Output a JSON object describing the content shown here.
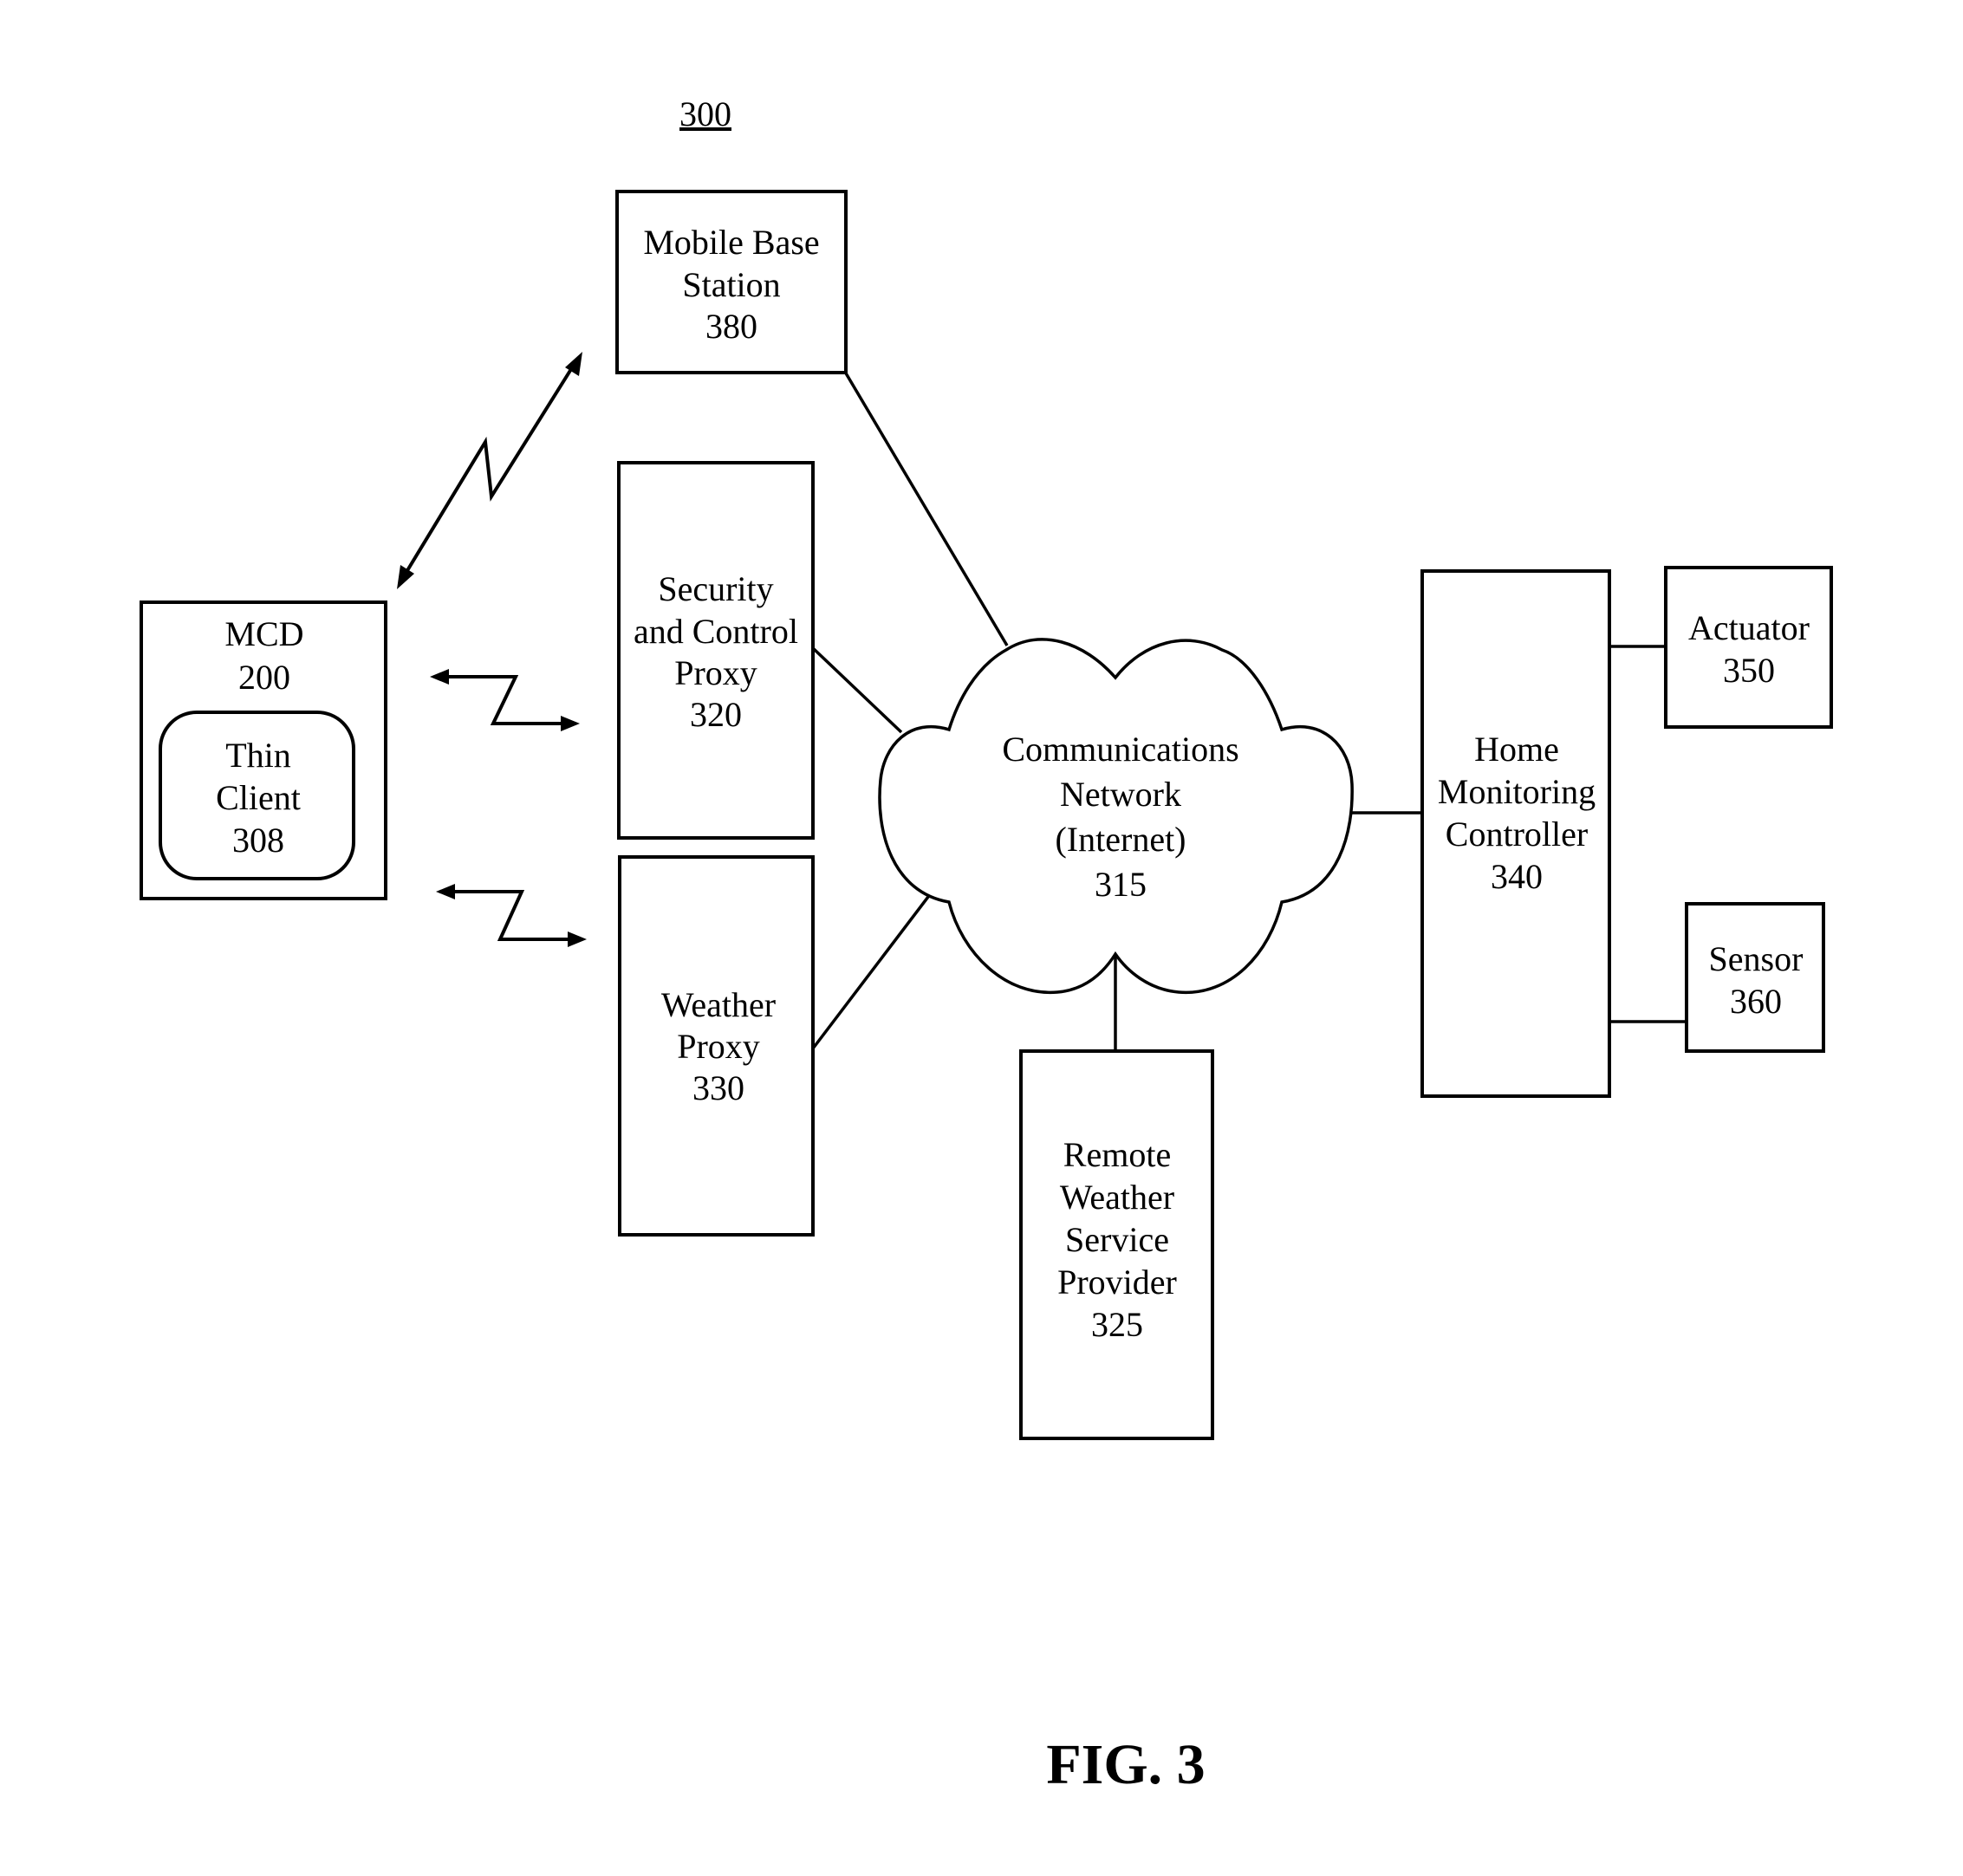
{
  "figure": {
    "reference_number": "300",
    "caption": "FIG. 3"
  },
  "nodes": {
    "mobile_base_station": {
      "lines": [
        "Mobile Base",
        "Station",
        "380"
      ]
    },
    "mcd": {
      "lines": [
        "MCD",
        "200"
      ]
    },
    "thin_client": {
      "lines": [
        "Thin",
        "Client",
        "308"
      ]
    },
    "security_proxy": {
      "lines": [
        "Security",
        "and Control",
        "Proxy",
        "320"
      ]
    },
    "weather_proxy": {
      "lines": [
        "Weather",
        "Proxy",
        "330"
      ]
    },
    "network": {
      "lines": [
        "Communications",
        "Network",
        "(Internet)",
        "315"
      ]
    },
    "remote_weather": {
      "lines": [
        "Remote",
        "Weather",
        "Service",
        "Provider",
        "325"
      ]
    },
    "home_controller": {
      "lines": [
        "Home",
        "Monitoring",
        "Controller",
        "340"
      ]
    },
    "actuator": {
      "lines": [
        "Actuator",
        "350"
      ]
    },
    "sensor": {
      "lines": [
        "Sensor",
        "360"
      ]
    }
  },
  "connections": [
    {
      "from": "mcd",
      "to": "mobile_base_station",
      "type": "wireless"
    },
    {
      "from": "mcd",
      "to": "security_proxy",
      "type": "wireless"
    },
    {
      "from": "mcd",
      "to": "weather_proxy",
      "type": "wireless"
    },
    {
      "from": "mobile_base_station",
      "to": "network",
      "type": "wired"
    },
    {
      "from": "security_proxy",
      "to": "network",
      "type": "wired"
    },
    {
      "from": "weather_proxy",
      "to": "network",
      "type": "wired"
    },
    {
      "from": "remote_weather",
      "to": "network",
      "type": "wired"
    },
    {
      "from": "network",
      "to": "home_controller",
      "type": "wired"
    },
    {
      "from": "home_controller",
      "to": "actuator",
      "type": "wired"
    },
    {
      "from": "home_controller",
      "to": "sensor",
      "type": "wired"
    }
  ]
}
